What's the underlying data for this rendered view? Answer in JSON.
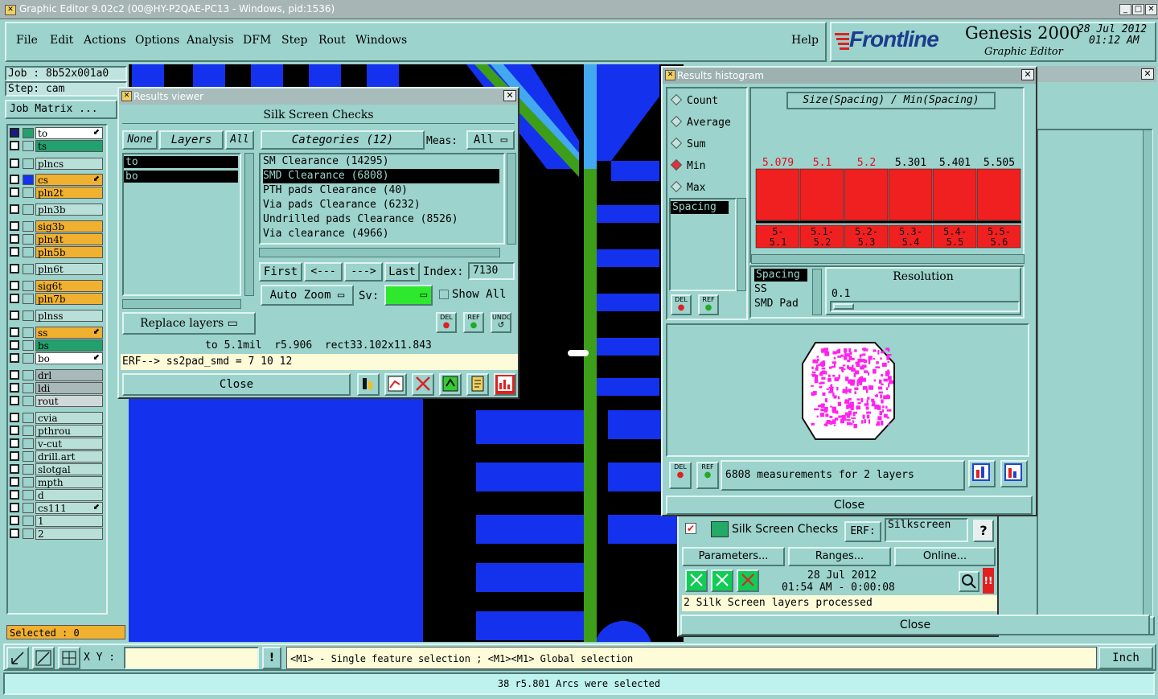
{
  "window": {
    "title": "Graphic Editor 9.02c2 (00@HY-P2QAE-PC13 - Windows, pid:1536)"
  },
  "menu": {
    "items": [
      "File",
      "Edit",
      "Actions",
      "Options",
      "Analysis",
      "DFM",
      "Step",
      "Rout",
      "Windows"
    ],
    "help": "Help"
  },
  "brand": {
    "logo": "Frontline",
    "product": "Genesis 2000",
    "subtitle": "Graphic Editor",
    "date": "28 Jul 2012",
    "time": "01:12 AM"
  },
  "job": {
    "job": "Job : 8b52x001a0",
    "step": "Step: cam",
    "matrix": "Job Matrix ...",
    "selected": "Selected : 0"
  },
  "layers": [
    {
      "name": "to",
      "color": "#ffffff",
      "arrow": true
    },
    {
      "name": "ts",
      "color": "#22a06e"
    },
    {
      "name": "plncs",
      "color": "#b8e0d8"
    },
    {
      "name": "cs",
      "color": "#f0b030",
      "arrow": true
    },
    {
      "name": "pln2t",
      "color": "#f0b030"
    },
    {
      "name": "pln3b",
      "color": "#b8e0d8"
    },
    {
      "name": "sig3b",
      "color": "#f0b030"
    },
    {
      "name": "pln4t",
      "color": "#f0b030"
    },
    {
      "name": "pln5b",
      "color": "#f0b030"
    },
    {
      "name": "pln6t",
      "color": "#b8e0d8"
    },
    {
      "name": "sig6t",
      "color": "#f0b030"
    },
    {
      "name": "pln7b",
      "color": "#f0b030"
    },
    {
      "name": "plnss",
      "color": "#b8e0d8"
    },
    {
      "name": "ss",
      "color": "#f0b030",
      "arrow": true
    },
    {
      "name": "bs",
      "color": "#22a06e"
    },
    {
      "name": "bo",
      "color": "#ffffff",
      "arrow": true
    },
    {
      "name": "drl",
      "color": "#a9b8b8"
    },
    {
      "name": "ldi",
      "color": "#a9b8b8"
    },
    {
      "name": "rout",
      "color": "#d0d8d8"
    },
    {
      "name": "cvia",
      "color": "#b8e0d8"
    },
    {
      "name": "pthrou",
      "color": "#b8e0d8"
    },
    {
      "name": "v-cut",
      "color": "#b8e0d8"
    },
    {
      "name": "drill.art",
      "color": "#b8e0d8"
    },
    {
      "name": "slotgal",
      "color": "#b8e0d8"
    },
    {
      "name": "mpth",
      "color": "#b8e0d8"
    },
    {
      "name": "d",
      "color": "#b8e0d8"
    },
    {
      "name": "cs111",
      "color": "#b8e0d8",
      "arrow": true
    },
    {
      "name": "1",
      "color": "#b8e0d8"
    },
    {
      "name": "2",
      "color": "#b8e0d8"
    }
  ],
  "results_viewer": {
    "title": "Results viewer",
    "header": "Silk Screen Checks",
    "none": "None",
    "layers": "Layers",
    "all": "All",
    "layer_list": [
      "to",
      "bo"
    ],
    "categories_btn": "Categories (12)",
    "meas_label": "Meas:",
    "meas_value": "All",
    "categories": [
      "SM Clearance (14295)",
      "SMD Clearance (6808)",
      "PTH pads Clearance (40)",
      "Via pads Clearance (6232)",
      "Undrilled pads Clearance (8526)",
      "Via clearance (4966)"
    ],
    "first": "First",
    "prev": "<---",
    "next": "--->",
    "last": "Last",
    "index_label": "Index:",
    "index_value": "7130",
    "auto_zoom": "Auto Zoom",
    "sv_label": "Sv:",
    "show_all": "Show All",
    "replace_layers": "Replace layers",
    "del": "DEL",
    "ref": "REF",
    "undo": "UNDO",
    "info": "to 5.1mil  r5.906  rect33.102x11.843",
    "erf": "ERF--> ss2pad_smd = 7 10 12",
    "close": "Close"
  },
  "histogram": {
    "title": "Results histogram",
    "options": [
      "Count",
      "Average",
      "Sum",
      "Min",
      "Max"
    ],
    "selected_option": "Min",
    "header": "Size(Spacing) / Min(Spacing)",
    "list_item": "Spacing",
    "del": "DEL",
    "ref": "REF",
    "res_list": [
      "Spacing",
      "SS",
      "SMD Pad"
    ],
    "resolution_label": "Resolution",
    "resolution_value": "0.1",
    "measurements": "6808 measurements for 2 layers",
    "close": "Close"
  },
  "chart_data": {
    "type": "bar",
    "title": "Size(Spacing) / Min(Spacing)",
    "categories": [
      "5-5.1",
      "5.1-5.2",
      "5.2-5.3",
      "5.3-5.4",
      "5.4-5.5",
      "5.5-5.6"
    ],
    "bin_labels": [
      [
        "5-",
        "5.1"
      ],
      [
        "5.1-",
        "5.2"
      ],
      [
        "5.2-",
        "5.3"
      ],
      [
        "5.3-",
        "5.4"
      ],
      [
        "5.4-",
        "5.5"
      ],
      [
        "5.5-",
        "5.6"
      ]
    ],
    "value_labels": [
      "5.079",
      "5.1",
      "5.2",
      "5.301",
      "5.401",
      "5.505"
    ],
    "values": [
      5.079,
      5.1,
      5.2,
      5.301,
      5.401,
      5.505
    ],
    "label_colors": [
      "#e01020",
      "#e01020",
      "#e01020",
      "#000000",
      "#000000",
      "#000000"
    ],
    "bar_color": "#f02020"
  },
  "checklist": {
    "name": "Silk Screen Checks",
    "erf_label": "ERF:",
    "erf_value": "Silkscreen",
    "help": "?",
    "parameters": "Parameters...",
    "ranges": "Ranges...",
    "online": "Online...",
    "date": "28 Jul 2012",
    "time": "01:54 AM - 0:00:08",
    "status": "2 Silk Screen layers processed",
    "close": "Close"
  },
  "bottom": {
    "xy_label": "X Y :",
    "xy_value": "",
    "hint": "<M1> - Single feature selection ; <M1><M1> Global selection",
    "units": "Inch",
    "status": "38 r5.801 Arcs were selected"
  }
}
